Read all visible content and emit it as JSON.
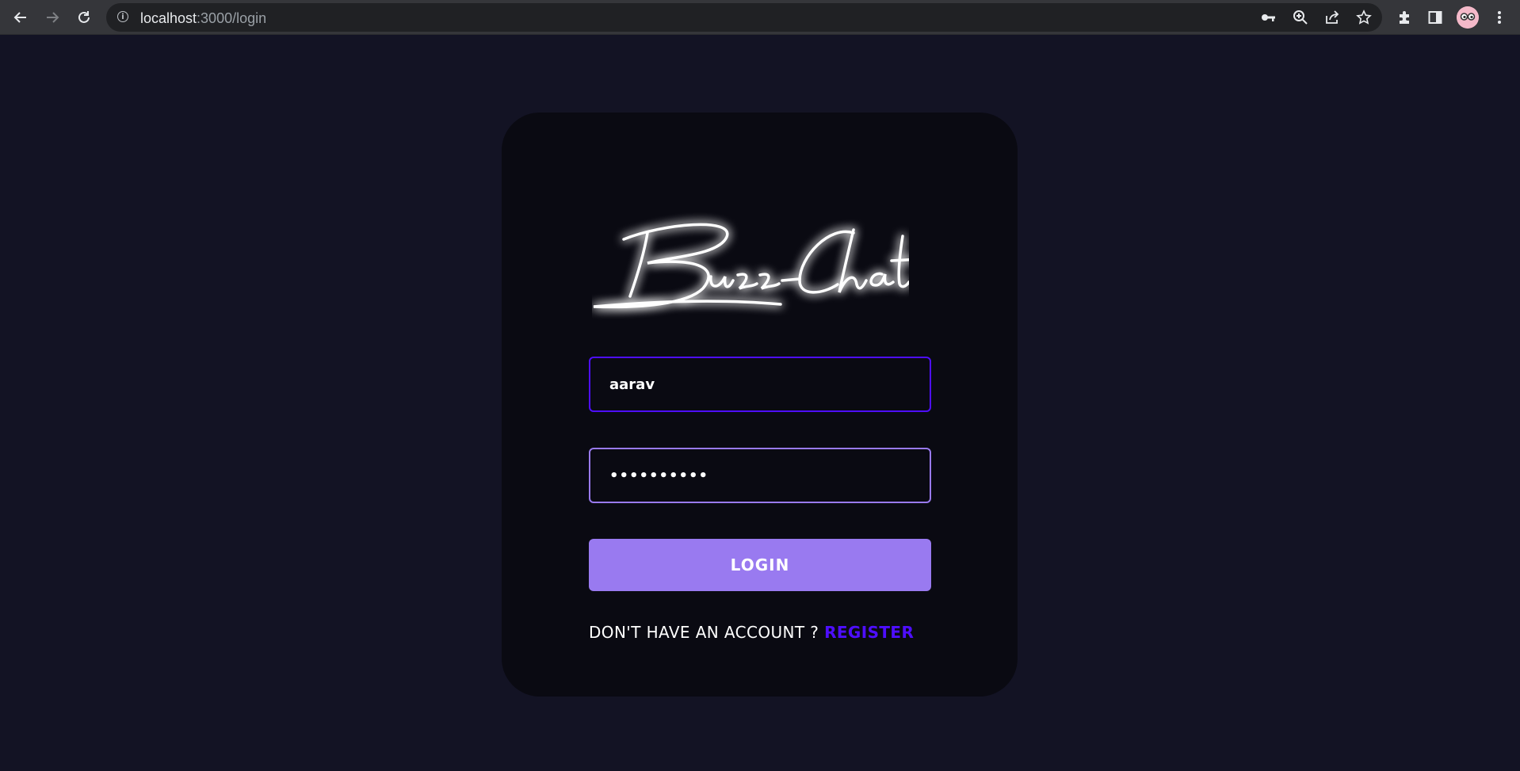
{
  "browser": {
    "back_icon": "arrow-left-icon",
    "forward_icon": "arrow-right-icon",
    "reload_icon": "reload-icon",
    "url_host": "localhost",
    "url_path": ":3000/login",
    "omnibox_icons": [
      "key-icon",
      "zoom-icon",
      "share-icon",
      "star-icon"
    ],
    "toolbar_icons": [
      "extensions-icon",
      "side-panel-icon",
      "profile-avatar",
      "menu-icon"
    ]
  },
  "login": {
    "logo_text": "Buzz-Chat",
    "username_value": "aarav",
    "password_mask": "••••••••••",
    "login_button": "LOGIN",
    "register_prompt": "DON'T HAVE AN ACCOUNT ?",
    "register_link": "REGISTER"
  },
  "colors": {
    "page_bg": "#131324",
    "card_bg": "#0a0a12",
    "accent": "#4e0eff",
    "button": "#997af0"
  }
}
